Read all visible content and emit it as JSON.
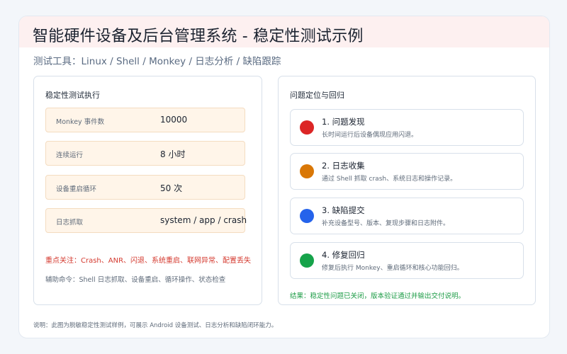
{
  "header": {
    "title": "智能硬件设备及后台管理系统 - 稳定性测试示例",
    "tools_line": "测试工具：Linux / Shell / Monkey / 日志分析 / 缺陷跟踪"
  },
  "left_panel": {
    "title": "稳定性测试执行",
    "metrics": [
      {
        "label": "Monkey 事件数",
        "value": "10000"
      },
      {
        "label": "连续运行",
        "value": "8 小时"
      },
      {
        "label": "设备重启循环",
        "value": "50 次"
      },
      {
        "label": "日志抓取",
        "value": "system / app / crash"
      }
    ],
    "focus_note": "重点关注：Crash、ANR、闪退、系统重启、联网异常、配置丢失",
    "command_note": "辅助命令：Shell 日志抓取、设备重启、循环操作、状态检查"
  },
  "right_panel": {
    "title": "问题定位与回归",
    "steps": [
      {
        "title": "1. 问题发现",
        "desc": "长时间运行后设备偶现应用闪退。",
        "color": "#dc2626"
      },
      {
        "title": "2. 日志收集",
        "desc": "通过 Shell 抓取 crash、系统日志和操作记录。",
        "color": "#d97706"
      },
      {
        "title": "3. 缺陷提交",
        "desc": "补充设备型号、版本、复现步骤和日志附件。",
        "color": "#2563eb"
      },
      {
        "title": "4. 修复回归",
        "desc": "修复后执行 Monkey、重启循环和核心功能回归。",
        "color": "#16a34a"
      }
    ],
    "result_note": "结果：稳定性问题已关闭，版本验证通过并输出交付说明。"
  },
  "footnote": "说明：此图为脱敏稳定性测试样例，可展示 Android 设备测试、日志分析和缺陷闭环能力。",
  "colors": {
    "title_band": "#fdf0f0",
    "metric_bg": "#fff5e9",
    "focus_red": "#d43a2f",
    "result_green": "#1f9d48"
  }
}
